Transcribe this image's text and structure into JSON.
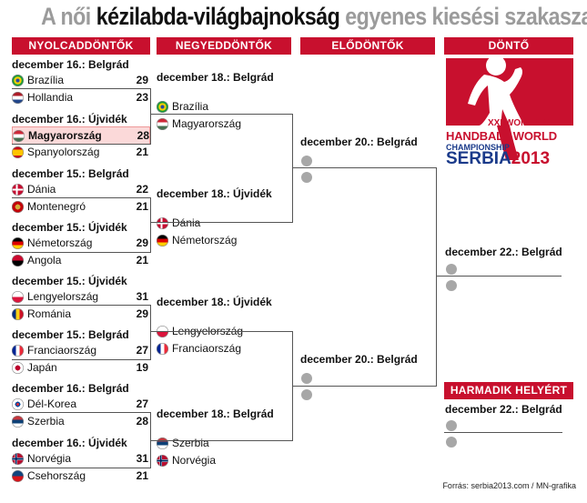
{
  "title": {
    "part1": "A női",
    "part2": "kézilabda-világbajnokság",
    "part3": "egyenes kiesési szakasza"
  },
  "columns": {
    "r16": "NYOLCADDÖNTŐK",
    "qf": "NEGYEDDÖNTŐK",
    "sf": "ELŐDÖNTŐK",
    "final": "DÖNTŐ",
    "third": "HARMADIK HELYÉRT"
  },
  "r16": [
    {
      "date": "december 16.: Belgrád",
      "teams": [
        {
          "name": "Brazília",
          "score": "29",
          "flag": "brazil"
        },
        {
          "name": "Hollandia",
          "score": "23",
          "flag": "netherlands"
        }
      ]
    },
    {
      "date": "december 16.: Újvidék",
      "teams": [
        {
          "name": "Magyarország",
          "score": "28",
          "flag": "hungary"
        },
        {
          "name": "Spanyolország",
          "score": "21",
          "flag": "spain"
        }
      ]
    },
    {
      "date": "december 15.: Belgrád",
      "teams": [
        {
          "name": "Dánia",
          "score": "22",
          "flag": "denmark"
        },
        {
          "name": "Montenegró",
          "score": "21",
          "flag": "montenegro"
        }
      ]
    },
    {
      "date": "december 15.: Újvidék",
      "teams": [
        {
          "name": "Németország",
          "score": "29",
          "flag": "germany"
        },
        {
          "name": "Angola",
          "score": "21",
          "flag": "angola"
        }
      ]
    },
    {
      "date": "december 15.: Újvidék",
      "teams": [
        {
          "name": "Lengyelország",
          "score": "31",
          "flag": "poland"
        },
        {
          "name": "Románia",
          "score": "29",
          "flag": "romania"
        }
      ]
    },
    {
      "date": "december 15.: Belgrád",
      "teams": [
        {
          "name": "Franciaország",
          "score": "27",
          "flag": "france"
        },
        {
          "name": "Japán",
          "score": "19",
          "flag": "japan"
        }
      ]
    },
    {
      "date": "december 16.: Belgrád",
      "teams": [
        {
          "name": "Dél-Korea",
          "score": "27",
          "flag": "korea"
        },
        {
          "name": "Szerbia",
          "score": "28",
          "flag": "serbia"
        }
      ]
    },
    {
      "date": "december 16.: Újvidék",
      "teams": [
        {
          "name": "Norvégia",
          "score": "31",
          "flag": "norway"
        },
        {
          "name": "Csehország",
          "score": "21",
          "flag": "czech"
        }
      ]
    }
  ],
  "qf": [
    {
      "date": "december 18.: Belgrád",
      "teams": [
        {
          "name": "Brazília",
          "flag": "brazil"
        },
        {
          "name": "Magyarország",
          "flag": "hungary"
        }
      ]
    },
    {
      "date": "december 18.: Újvidék",
      "teams": [
        {
          "name": "Dánia",
          "flag": "denmark"
        },
        {
          "name": "Németország",
          "flag": "germany"
        }
      ]
    },
    {
      "date": "december 18.: Újvidék",
      "teams": [
        {
          "name": "Lengyelország",
          "flag": "poland"
        },
        {
          "name": "Franciaország",
          "flag": "france"
        }
      ]
    },
    {
      "date": "december 18.: Belgrád",
      "teams": [
        {
          "name": "Szerbia",
          "flag": "serbia"
        },
        {
          "name": "Norvégia",
          "flag": "norway"
        }
      ]
    }
  ],
  "sf": [
    {
      "date": "december 20.: Belgrád"
    },
    {
      "date": "december 20.: Belgrád"
    }
  ],
  "final": {
    "date": "december 22.: Belgrád"
  },
  "third": {
    "date": "december 22.: Belgrád"
  },
  "logo": {
    "line1": "XXI WOMEN'S",
    "line2": "HANDBALL WORLD",
    "line3": "CHAMPIONSHIP",
    "line4": "SERBIA",
    "line5": "2013"
  },
  "source": "Forrás: serbia2013.com / MN-grafika",
  "colors": {
    "accent": "#c8102e",
    "logo_blue": "#1a3a8a",
    "winner_bg": "#fbd9d9"
  }
}
